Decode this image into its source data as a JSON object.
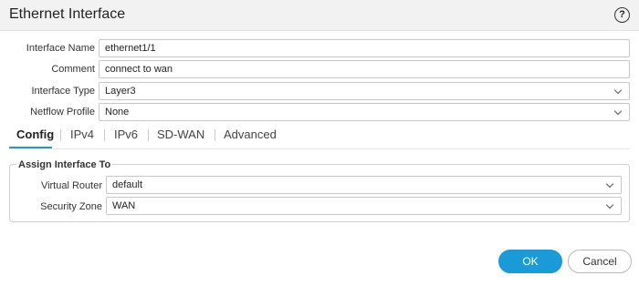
{
  "dialog": {
    "title": "Ethernet Interface",
    "help_icon": "help-circle-icon",
    "help_glyph": "?"
  },
  "form": {
    "interface_name": {
      "label": "Interface Name",
      "value": "ethernet1/1"
    },
    "comment": {
      "label": "Comment",
      "value": "connect to wan"
    },
    "interface_type": {
      "label": "Interface Type",
      "value": "Layer3"
    },
    "netflow_profile": {
      "label": "Netflow Profile",
      "value": "None"
    }
  },
  "tabs": [
    {
      "label": "Config",
      "active": true
    },
    {
      "label": "IPv4"
    },
    {
      "label": "IPv6"
    },
    {
      "label": "SD-WAN"
    },
    {
      "label": "Advanced"
    }
  ],
  "assign": {
    "legend": "Assign Interface To",
    "virtual_router": {
      "label": "Virtual Router",
      "value": "default"
    },
    "security_zone": {
      "label": "Security Zone",
      "value": "WAN"
    }
  },
  "buttons": {
    "ok": "OK",
    "cancel": "Cancel"
  },
  "colors": {
    "accent": "#1a9bd7",
    "titlebar_bg": "#f2f2f2"
  }
}
